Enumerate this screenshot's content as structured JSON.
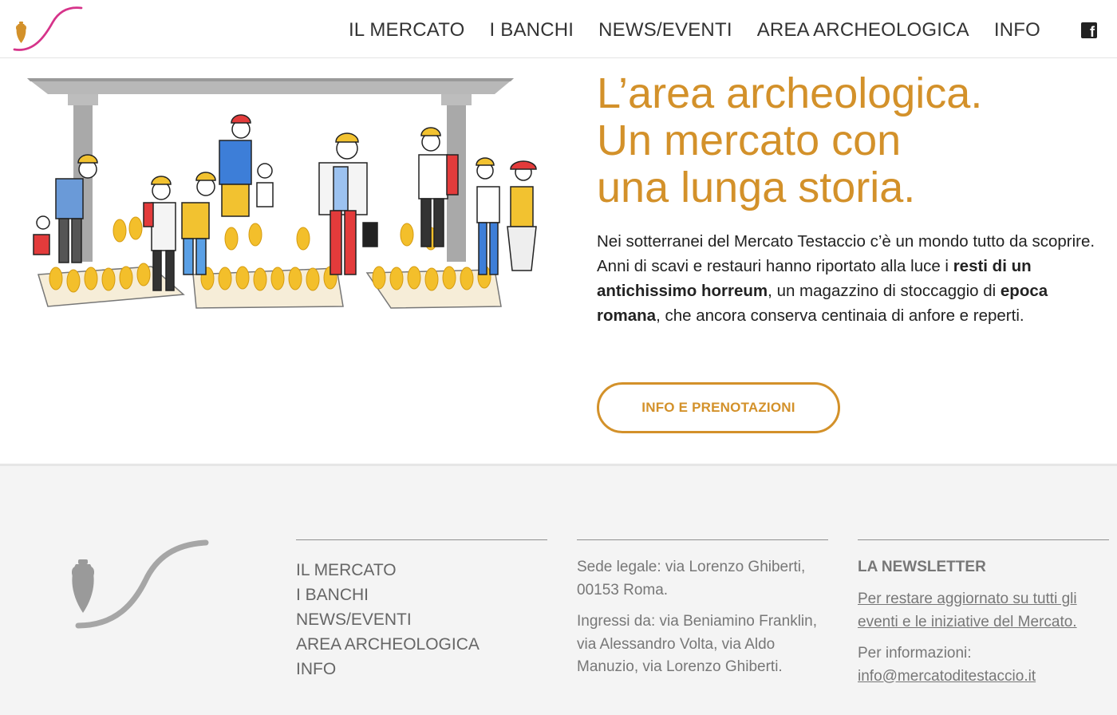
{
  "header": {
    "nav": [
      "IL MERCATO",
      "I BANCHI",
      "NEWS/EVENTI",
      "AREA ARCHEOLOGICA",
      "INFO"
    ],
    "facebook_icon": "facebook-icon",
    "facebook_glyph": "f"
  },
  "hero": {
    "title_lines": [
      "L’area archeologica.",
      "Un mercato con",
      "una lunga storia."
    ],
    "body": {
      "t1": "Nei sotterranei del Mercato Testaccio c’è un mondo tutto da scoprire. Anni di scavi e restauri hanno riportato alla luce i ",
      "b1": "resti di un antichissimo horreum",
      "t2": ", un magazzino di stoccaggio di ",
      "b2": "epoca romana",
      "t3": ", che ancora conserva centinaia di anfore e reperti."
    },
    "cta_label": "INFO E PRENOTAZIONI"
  },
  "footer": {
    "nav": [
      "IL MERCATO",
      "I BANCHI",
      "NEWS/EVENTI",
      "AREA ARCHEOLOGICA",
      "INFO"
    ],
    "address": "Sede legale: via Lorenzo Ghiberti, 00153 Roma.",
    "entrances": "Ingressi da: via Beniamino Franklin, via Alessandro Volta, via Aldo Manuzio, via Lorenzo Ghiberti.",
    "newsletter_title": "LA NEWSLETTER",
    "newsletter_link": "Per restare aggiornato su tutti gli eventi e le iniziative del Mercato.",
    "info_label": "Per informazioni:",
    "email": "info@mercatoditestaccio.it"
  },
  "colors": {
    "accent": "#d3912a",
    "logo_pink": "#d6338a",
    "footer_bg": "#f4f4f4"
  }
}
